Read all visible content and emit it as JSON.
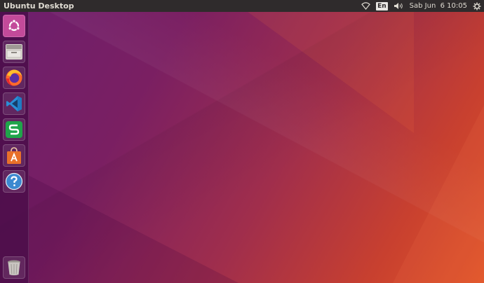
{
  "topbar": {
    "title": "Ubuntu Desktop",
    "language": "En",
    "clock": "Sab Jun  6 10:05"
  },
  "launcher": {
    "items": [
      {
        "name": "ubuntu-dash",
        "icon": "ubuntu-logo-icon"
      },
      {
        "name": "files",
        "icon": "file-cabinet-icon"
      },
      {
        "name": "firefox",
        "icon": "firefox-icon"
      },
      {
        "name": "vscode",
        "icon": "vscode-icon"
      },
      {
        "name": "spreadsheet",
        "icon": "spreadsheet-s-icon"
      },
      {
        "name": "software-center",
        "icon": "shopping-bag-a-icon"
      },
      {
        "name": "help",
        "icon": "help-question-icon"
      },
      {
        "name": "trash",
        "icon": "trash-icon"
      }
    ]
  },
  "colors": {
    "panel": "#2f2b2c",
    "launcher": "#460c46",
    "wallpaper_start": "#6c1f6e",
    "wallpaper_end": "#e0552a"
  }
}
